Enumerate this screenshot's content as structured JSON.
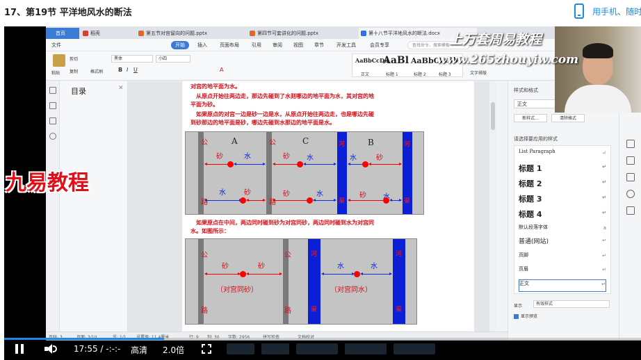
{
  "page": {
    "title": "17、第19节 平洋地风水的断法",
    "phone_link": "用手机、随时"
  },
  "wps": {
    "tabs": [
      {
        "label": "首页",
        "color": "#ffffff"
      },
      {
        "label": "稻壳",
        "color": "#e03a2f"
      },
      {
        "label": "第五节对宫留向的问题.pptx",
        "color": "#e0662f"
      },
      {
        "label": "第四节可套讲化的问题.pptx",
        "color": "#e0662f"
      },
      {
        "label": "第十八节平洋地风水的断法.docx",
        "color": "#2f6fe0"
      }
    ],
    "menu": [
      "文件",
      "开始",
      "插入",
      "页面布局",
      "引用",
      "审阅",
      "视图",
      "章节",
      "开发工具",
      "会员专享"
    ],
    "search_placeholder": "查找命令、搜索模板",
    "ribbon": {
      "paste": "粘贴",
      "cut": "剪切",
      "copy": "复制",
      "format_painter": "格式刷",
      "font": "黑体",
      "size": "小四",
      "styles": [
        {
          "sample": "AaBbCcDd",
          "label": "正文"
        },
        {
          "sample": "AaBl",
          "label": "标题 1"
        },
        {
          "sample": "AaBbC",
          "label": "标题 2"
        },
        {
          "sample": "AaBbC",
          "label": "标题 3"
        }
      ],
      "text_layout": "文字排版"
    },
    "toc_title": "目录",
    "document": {
      "lines": [
        "对宫的地平面为水。",
        "　从原点开始往两边走，那边先碰到了水则哪边的地平面为水，其对宫的地",
        "平面为砂。",
        "　如果原点的对宫一边是砂一边是水，从原点开始往两边走，也是哪边先碰",
        "到砂那边的地平面是砂，哪边先碰到水那边的地平面是水。"
      ],
      "lines2": [
        "　如果原点在中间，两边同时碰到砂为对宫同砂，两边同时碰到水为对宫同",
        "水。如图所示："
      ],
      "line2_black": "如图所示：",
      "diagram1": {
        "letters": [
          "A",
          "C",
          "B"
        ],
        "gong": "公",
        "lu": "路",
        "he": "河",
        "qu": "渠",
        "sha": "砂",
        "shui": "水"
      },
      "diagram2": {
        "gong": "公",
        "lu": "路",
        "he": "河",
        "qu": "渠",
        "sha": "砂",
        "shui": "水",
        "left_caption": "（对宫同砂）",
        "right_caption": "（对宫同水）"
      }
    },
    "right_panel": {
      "header": "样式和格式",
      "current_style": "正文",
      "new_style": "新样式...",
      "clear_format": "清除格式",
      "select_label": "请选择要应用的样式",
      "styles": [
        "List Paragraph",
        "标题 1",
        "标题 2",
        "标题 3",
        "标题 4",
        "默认段落字体",
        "普通(网站)",
        "页脚",
        "页眉",
        "正文"
      ],
      "show_label": "显示",
      "show_value": "有效样式",
      "preview_label": "显示预览"
    },
    "statusbar": [
      "页码: 3",
      "页面: 3/10",
      "节: 1/1",
      "设置值: 11.4厘米",
      "行: 9",
      "列: 30",
      "字数: 2956",
      "拼写检查",
      "文档校对"
    ]
  },
  "overlay": {
    "watermark_title": "上万套周易教程",
    "watermark_url": "www.265zhouyiw.com",
    "brand": "九易教程"
  },
  "player": {
    "time_current": "17:55",
    "time_sep": "/",
    "time_total": "-:-:-",
    "quality": "高清",
    "speed": "2.0倍"
  },
  "colors": {
    "accent": "#1a8ae6",
    "doc_red": "#d0101a",
    "river_blue": "#0a1fd6",
    "diagram_gray": "#c4c4c4"
  }
}
